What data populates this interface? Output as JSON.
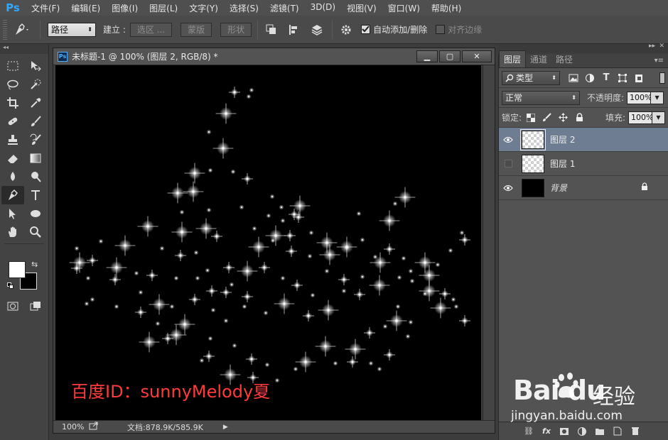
{
  "app": {
    "logo": "Ps"
  },
  "menu": [
    "文件(F)",
    "编辑(E)",
    "图像(I)",
    "图层(L)",
    "文字(Y)",
    "选择(S)",
    "滤镜(T)",
    "3D(D)",
    "视图(V)",
    "窗口(W)",
    "帮助(H)"
  ],
  "options": {
    "mode_select": "路径",
    "make_label": "建立 :",
    "selection_btn": "选区 ...",
    "mask_btn": "蒙版",
    "shape_btn": "形状",
    "auto_add_delete": "自动添加/删除",
    "auto_add_delete_checked": true,
    "align_edges": "对齐边缘",
    "align_edges_checked": false
  },
  "document": {
    "title": "未标题-1 @ 100% (图层 2, RGB/8) *",
    "watermark_text": "百度ID：sunnyMelody夏",
    "zoom": "100%",
    "doc_size": "文档:878.9K/585.9K",
    "min_btn": "▁",
    "max_btn": "▢",
    "close_btn": "✕"
  },
  "layers_panel": {
    "tabs": [
      "图层",
      "通道",
      "路径"
    ],
    "active_tab": "图层",
    "filter_kind": "类型",
    "blend_mode": "正常",
    "opacity_label": "不透明度:",
    "opacity_value": "100%",
    "lock_label": "锁定:",
    "fill_label": "填充:",
    "fill_value": "100%",
    "layers": [
      {
        "name": "图层 2",
        "visible": true,
        "selected": true,
        "thumb": "transparent",
        "locked": false
      },
      {
        "name": "图层 1",
        "visible": false,
        "selected": false,
        "thumb": "transparent",
        "locked": false
      },
      {
        "name": "背景",
        "visible": true,
        "selected": false,
        "thumb": "black",
        "locked": true
      }
    ]
  },
  "watermark": {
    "brand": "Bai du",
    "product": "经验",
    "url": "jingyan.baidu.com"
  },
  "colors": {
    "foreground": "#ffffff",
    "background": "#000000",
    "watermark_text": "#ff3a3a",
    "selected_layer": "#6f7d93",
    "ps_blue": "#31a8ff"
  }
}
